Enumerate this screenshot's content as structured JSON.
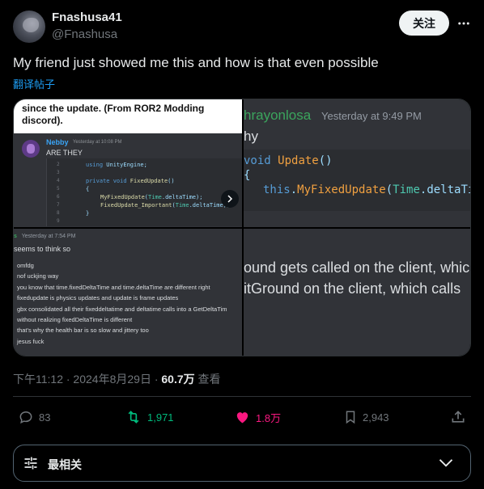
{
  "author": {
    "display_name": "Fnashusa41",
    "handle": "@Fnashusa"
  },
  "follow_label": "关注",
  "tweet": {
    "text": "My friend just showed me this and how is that even possible",
    "translate_label": "翻译帖子"
  },
  "media": {
    "cell1": {
      "caption_line1": "since the update. (From ROR2 Modding",
      "caption_line2": "discord).",
      "user": "Nebby",
      "time": "Yesterday at 10:08 PM",
      "message": "ARE THEY",
      "line_numbers": [
        "2",
        "3",
        "4",
        "5",
        "6",
        "7",
        "8",
        "9"
      ]
    },
    "cell2": {
      "user": "hrayonlosa",
      "time": "Yesterday at 9:49 PM",
      "message": "hy"
    },
    "cell3": {
      "user": "s",
      "time": "Yesterday at 7:54 PM",
      "message": "seems to think so",
      "lines": [
        "omfdg",
        "nof uckjing way",
        "you know that time.fixedDeltaTime and time.deltaTime are different right",
        "fixedupdate is physics updates and update is frame updates",
        "gbx consolidated all their fixeddeltatime and deltatime calls into a GetDeltaTim",
        "without realizing fixedDeltaTime is different",
        "that's why the health bar is so slow and jittery too",
        "jesus fuck"
      ]
    },
    "cell4": {
      "line1": "ound gets called on the client, whic",
      "line2": "itGround on the client, which calls"
    }
  },
  "meta": {
    "datetime": "下午11:12 · 2024年8月29日 · ",
    "views": "60.7万",
    "views_label": " 查看"
  },
  "actions": {
    "replies": "83",
    "reposts": "1,971",
    "likes": "1.8万",
    "bookmarks": "2,943"
  },
  "sort": {
    "label": "最相关"
  },
  "colors": {
    "repost_green": "#00ba7c",
    "like_pink": "#f91880",
    "link_blue": "#1d9bf0"
  }
}
